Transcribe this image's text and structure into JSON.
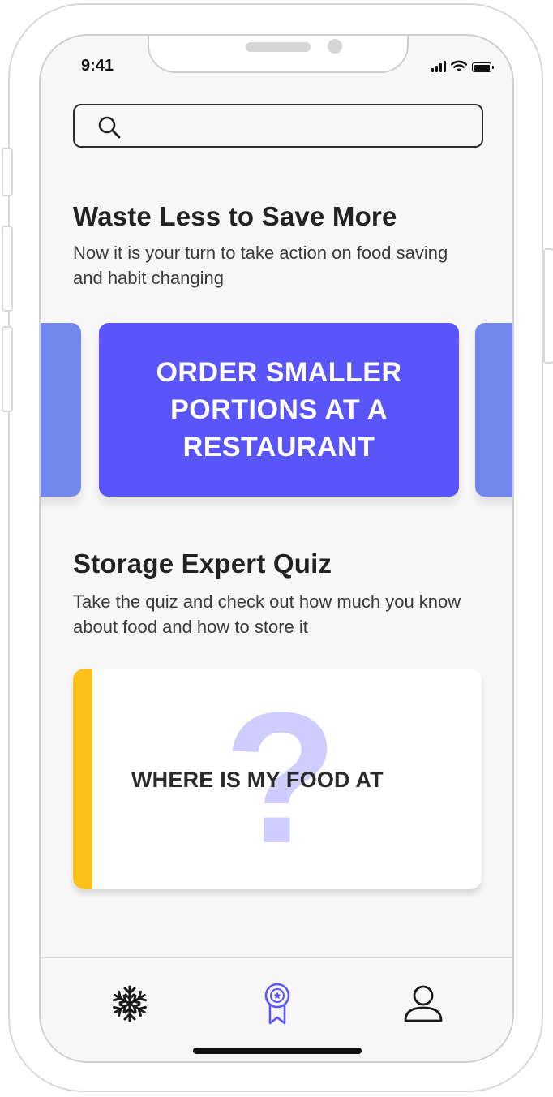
{
  "status_bar": {
    "time": "9:41",
    "battery_level": 1.0
  },
  "search": {
    "placeholder": "",
    "icon": "search-icon"
  },
  "waste_section": {
    "title": "Waste Less to Save More",
    "subtitle": "Now it is your turn to take action on food saving and habit changing",
    "cards": [
      {
        "label": "",
        "color": "#7388ee"
      },
      {
        "label": "ORDER SMALLER PORTIONS AT A RESTAURANT",
        "color": "#5a55fb"
      },
      {
        "label": "",
        "color": "#7388ee"
      }
    ]
  },
  "quiz_section": {
    "title": "Storage Expert Quiz",
    "subtitle": "Take the quiz and check out how much you know about food and how to store it",
    "card": {
      "label": "WHERE IS MY FOOD AT",
      "background_glyph": "?",
      "accent_color": "#fbc21b",
      "glyph_color": "#cfcdfd"
    }
  },
  "tabbar": {
    "tabs": [
      {
        "name": "freezer",
        "icon": "snowflake-icon",
        "active": false
      },
      {
        "name": "rewards",
        "icon": "award-ribbon-icon",
        "active": true
      },
      {
        "name": "profile",
        "icon": "user-icon",
        "active": false
      }
    ],
    "active_color": "#5a55fb"
  }
}
